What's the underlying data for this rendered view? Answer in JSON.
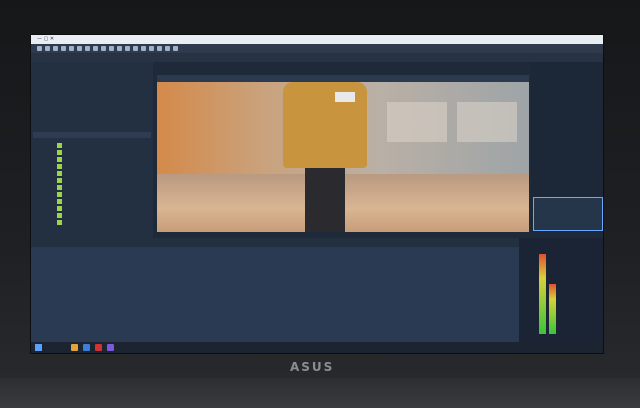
{
  "device": {
    "brand": "ASUS"
  },
  "window": {
    "title_bar": "",
    "controls": "— ▢ ✕"
  },
  "tabs": [
    "",
    "",
    ""
  ],
  "left_panel": {
    "files": [
      {
        "name": "",
        "desc": ""
      },
      {
        "name": "",
        "desc": ""
      },
      {
        "name": "",
        "desc": ""
      },
      {
        "name": "",
        "desc": ""
      },
      {
        "name": "",
        "desc": ""
      },
      {
        "name": "",
        "desc": ""
      },
      {
        "name": "",
        "desc": ""
      },
      {
        "name": "",
        "desc": ""
      },
      {
        "name": "",
        "desc": ""
      },
      {
        "name": "",
        "desc": ""
      },
      {
        "name": "",
        "desc": ""
      },
      {
        "name": "",
        "desc": ""
      }
    ]
  },
  "preview": {
    "header": ""
  },
  "right_panel": {
    "labels": [
      "",
      "",
      ""
    ]
  },
  "timeline": {
    "rows": [
      "",
      "",
      "",
      "",
      "",
      ""
    ]
  },
  "taskbar": {
    "clock": ""
  },
  "colors": {
    "accent": "#6aa9ff",
    "file_icon": "#9bd54a",
    "coat": "#c9943e"
  }
}
